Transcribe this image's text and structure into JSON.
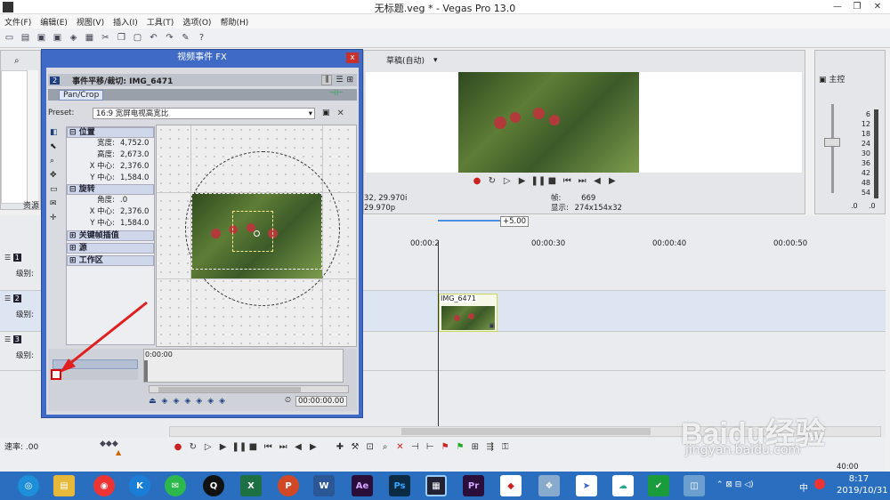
{
  "window": {
    "title": "无标题.veg * - Vegas Pro 13.0",
    "minimize": "—",
    "restore": "❐",
    "close": "✕"
  },
  "menu": [
    "文件(F)",
    "编辑(E)",
    "视图(V)",
    "插入(I)",
    "工具(T)",
    "选项(O)",
    "帮助(H)"
  ],
  "left_panel": {
    "tab_label": "资源"
  },
  "preview_toolbar": {
    "quality": "草稿(自动)"
  },
  "preview_info": {
    "project_line1": "32, 29.970i",
    "project_line2": "29.970p",
    "frame_label": "帧:",
    "frame_value": "669",
    "display_label": "显示:",
    "display_value": "274x154x32"
  },
  "master": {
    "title": "主控",
    "meter_labels": [
      "6",
      "12",
      "18",
      "24",
      "30",
      "36",
      "42",
      "48",
      "54"
    ],
    "left_bottom": ".0",
    "right_bottom": ".0"
  },
  "dialog": {
    "title": "视频事件 FX",
    "close": "x",
    "track_num": "2",
    "header_label": "事件平移/裁切: IMG_6471",
    "tab": "Pan/Crop",
    "preset_label": "Preset:",
    "preset_value": "16:9 宽屏电视高宽比",
    "sections": {
      "position": "位置",
      "rotation": "旋转",
      "keyframe": "关键帧插值",
      "source": "源",
      "workspace": "工作区"
    },
    "props": {
      "width_k": "宽度:",
      "width_v": "4,752.0",
      "height_k": "高度:",
      "height_v": "2,673.0",
      "xcenter_k": "X 中心:",
      "xcenter_v": "2,376.0",
      "ycenter_k": "Y 中心:",
      "ycenter_v": "1,584.0",
      "angle_k": "角度:",
      "angle_v": ".0",
      "rxcenter_k": "X 中心:",
      "rxcenter_v": "2,376.0",
      "rycenter_k": "Y 中心:",
      "rycenter_v": "1,584.0"
    },
    "kf_time_start": "0:00:00",
    "kf_time_end": "00:00:00.00"
  },
  "timeline": {
    "playhead_badge": "+5.00",
    "ruler": [
      "00:00:2",
      "00:00:30",
      "00:00:40",
      "00:00:50"
    ],
    "tracks": [
      {
        "num": "1",
        "level_label": "级别:"
      },
      {
        "num": "2",
        "level_label": "级别:"
      },
      {
        "num": "3",
        "level_label": "级别:"
      }
    ],
    "clip_name": "IMG_6471",
    "rate_label": "速率: .00",
    "bottom_time": "40:00"
  },
  "watermark": {
    "brand": "Baidu经验",
    "url": "jingyan.baidu.com"
  },
  "taskbar": {
    "time": "8:17",
    "date": "2019/10/31",
    "ime": "中"
  }
}
